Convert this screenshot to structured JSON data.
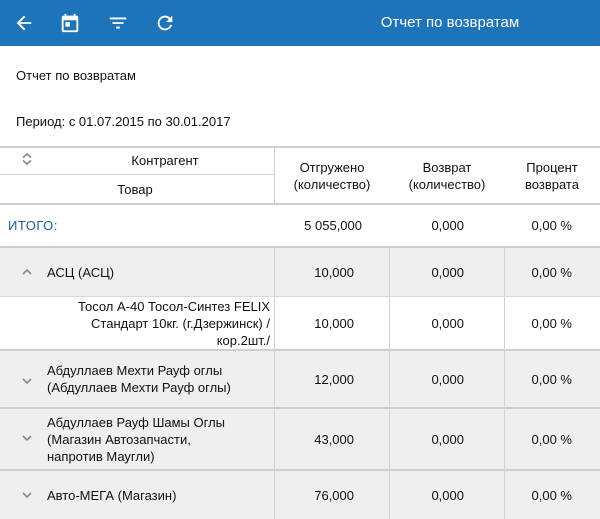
{
  "appbar": {
    "title": "Отчет по возвратам",
    "icons": [
      "back-arrow-icon",
      "calendar-icon",
      "filter-icon",
      "refresh-icon"
    ],
    "color": "#1d74b8"
  },
  "report": {
    "title": "Отчет по возвратам",
    "period": "Период: с 01.07.2015 по 30.01.2017"
  },
  "table": {
    "headers": {
      "contractor": "Контрагент",
      "product": "Товар",
      "shipped_l1": "Отгружено",
      "shipped_l2": "(количество)",
      "returned_l1": "Возврат",
      "returned_l2": "(количество)",
      "percent_l1": "Процент",
      "percent_l2": "возврата"
    },
    "total": {
      "label": "ИТОГО:",
      "shipped": "5 055,000",
      "returned": "0,000",
      "percent": "0,00 %"
    },
    "rows": [
      {
        "name_lines": [
          "АСЦ (АСЦ)"
        ],
        "shipped": "10,000",
        "returned": "0,000",
        "percent": "0,00 %"
      },
      {
        "name_lines": [
          "Тосол А-40 Тосол-Синтез FELIX",
          "Стандарт 10кг. (г.Дзержинск) /",
          "кор.2шт./"
        ],
        "shipped": "10,000",
        "returned": "0,000",
        "percent": "0,00 %"
      },
      {
        "name_lines": [
          "Абдуллаев Мехти Рауф оглы",
          "(Абдуллаев Мехти Рауф оглы)"
        ],
        "shipped": "12,000",
        "returned": "0,000",
        "percent": "0,00 %"
      },
      {
        "name_lines": [
          "Абдуллаев Рауф Шамы Оглы",
          "(Магазин Автозапчасти,",
          "напротив Маугли)"
        ],
        "shipped": "43,000",
        "returned": "0,000",
        "percent": "0,00 %"
      },
      {
        "name_lines": [
          "Авто-МЕГА (Магазин)"
        ],
        "shipped": "76,000",
        "returned": "0,000",
        "percent": "0,00 %"
      }
    ]
  }
}
